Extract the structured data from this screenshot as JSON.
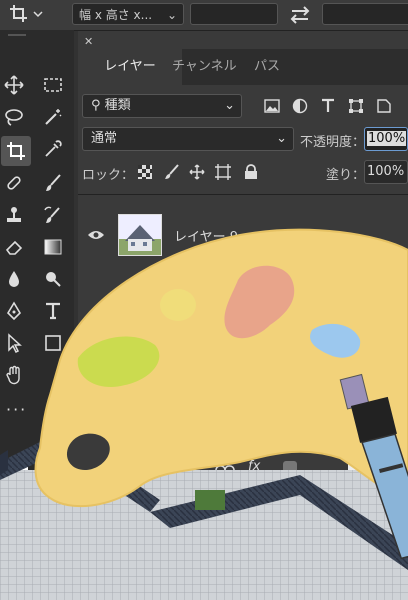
{
  "options_bar": {
    "ratio_label": "幅 x 高さ x...",
    "swap_icon": "swap-arrows-icon"
  },
  "panel": {
    "tabs": [
      "レイヤー",
      "チャンネル",
      "パス"
    ],
    "filter_kind": "種類",
    "blend_mode": "通常",
    "opacity_label": "不透明度：",
    "opacity_value": "100%",
    "lock_label": "ロック：",
    "fill_label": "塗り：",
    "fill_value": "100%",
    "layer_name": "レイヤー 9",
    "fx_label": "fx"
  },
  "colors": {
    "palette": "#f2d27a",
    "bg_dark": "#323232",
    "panel": "#3a3a3a",
    "accent_blue": "#9cc8ee",
    "accent_red": "#e8a48a",
    "accent_green": "#c6db4a"
  }
}
